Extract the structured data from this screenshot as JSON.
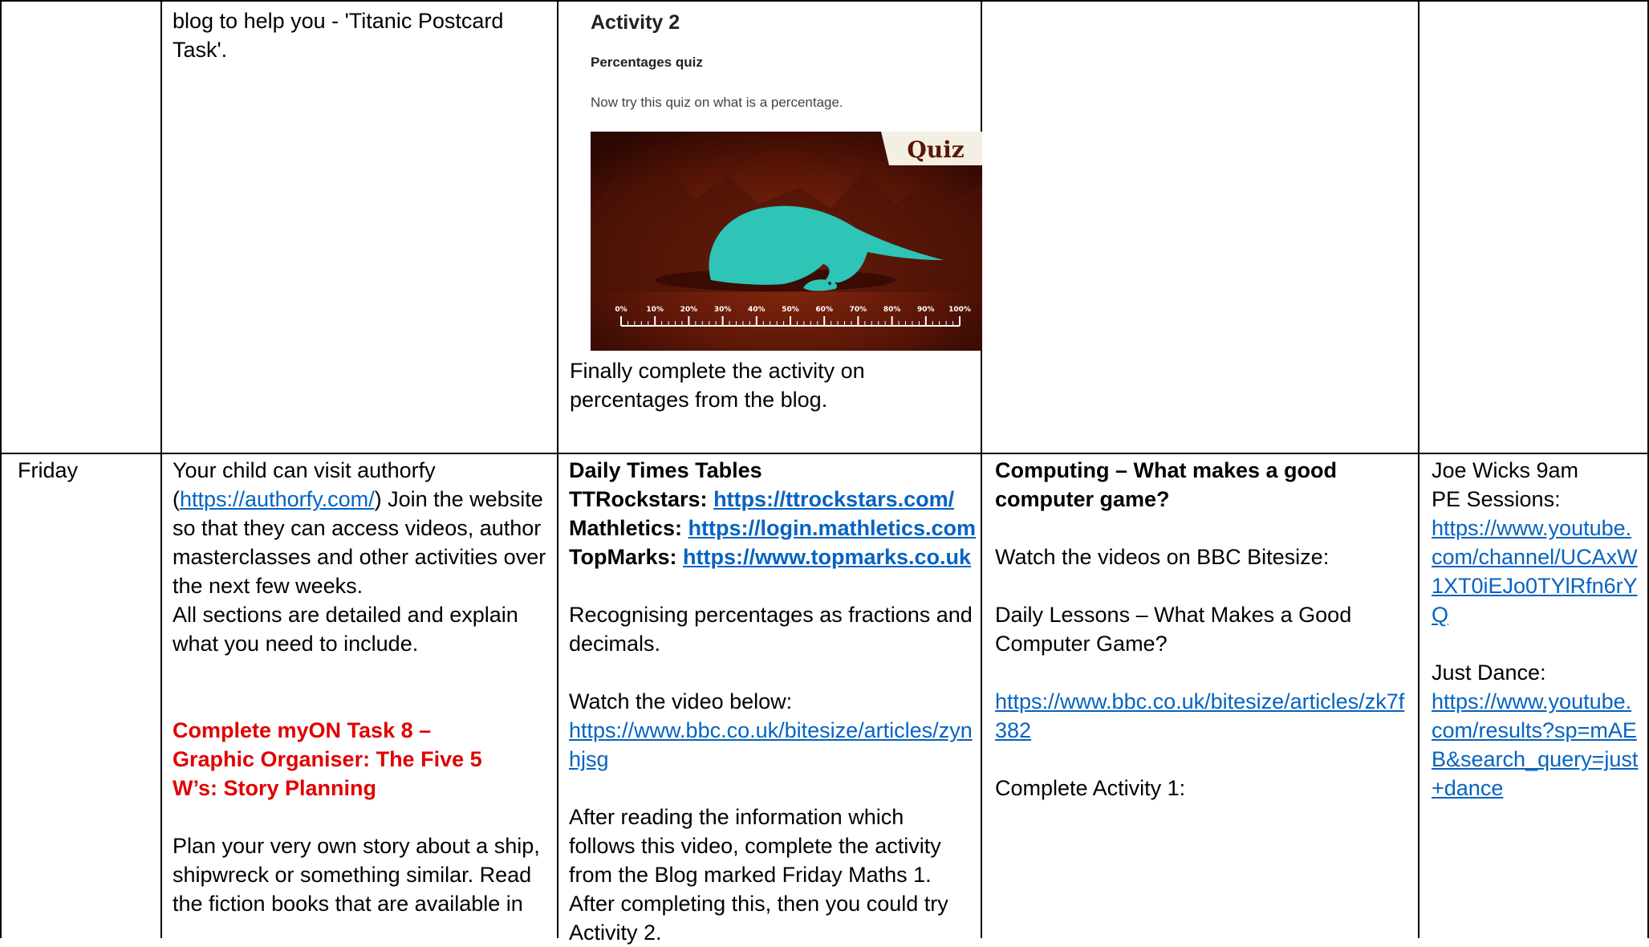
{
  "top_row": {
    "col1_text": "blog to help you - 'Titanic Postcard Task'.",
    "activity": {
      "heading": "Activity 2",
      "subheading": "Percentages quiz",
      "instruction": "Now try this quiz on what is a percentage.",
      "quiz_badge": "Quiz",
      "scale_labels": [
        "0%",
        "10%",
        "20%",
        "30%",
        "40%",
        "50%",
        "60%",
        "70%",
        "80%",
        "90%",
        "100%"
      ]
    },
    "col2_text": "Finally complete the activity on percentages from the blog."
  },
  "friday": {
    "day": "Friday",
    "english": {
      "intro_a": "Your child can visit authorfy (",
      "link": "https://authorfy.com/",
      "intro_b": ") Join the website so that they can access videos, author masterclasses and other activities over the next few weeks.",
      "detail": "All sections are detailed and explain what you need to include.",
      "task": "Complete myON Task 8 – Graphic Organiser: The Five 5 W’s: Story Planning",
      "plan": "Plan your very own story about a ship, shipwreck or something similar. Read the fiction books that are available in"
    },
    "maths": {
      "heading": "Daily Times Tables",
      "links": [
        {
          "label": "TTRockstars: ",
          "url": "https://ttrockstars.com/"
        },
        {
          "label": "Mathletics: ",
          "url": "https://login.mathletics.com"
        },
        {
          "label": "TopMarks: ",
          "url": "https://www.topmarks.co.uk"
        }
      ],
      "topic": "Recognising percentages as fractions and decimals.",
      "video_intro": "Watch the video below:",
      "video_link": "https://www.bbc.co.uk/bitesize/articles/zynhjsg",
      "after": "After reading the information which follows this video, complete the activity from the Blog marked Friday Maths 1. After completing this, then you could try Activity 2."
    },
    "computing": {
      "heading": "Computing – What makes a good computer game?",
      "watch": "Watch the videos on BBC Bitesize:",
      "lessons": "Daily Lessons – What Makes a Good Computer Game?",
      "link": "https://www.bbc.co.uk/bitesize/articles/zk7f382",
      "complete": "Complete Activity 1:"
    },
    "pe": {
      "joe": "Joe Wicks 9am PE Sessions:",
      "joe_link": "https://www.youtube.com/channel/UCAxW1XT0iEJo0TYlRfn6rYQ",
      "dance": "Just Dance:",
      "dance_link": "https://www.youtube.com/results?sp=mAEB&search_query=just+dance"
    }
  }
}
